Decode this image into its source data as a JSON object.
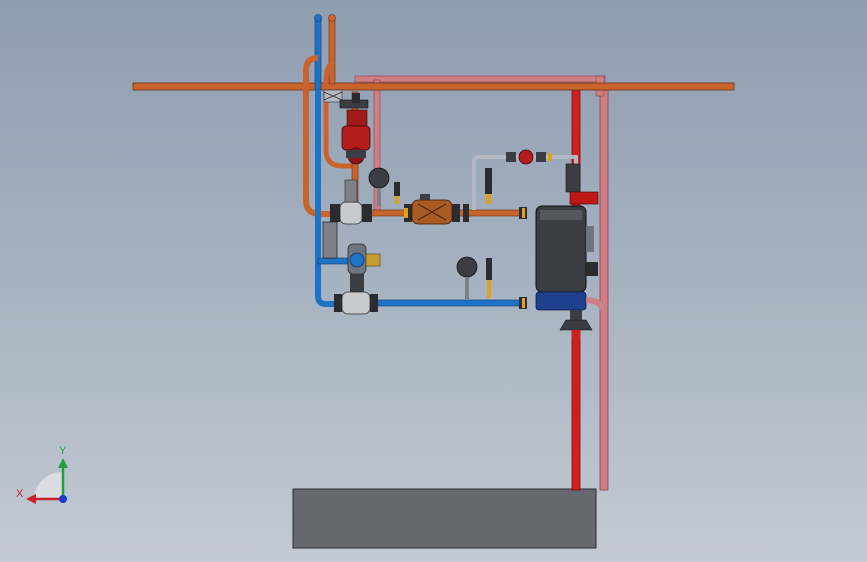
{
  "triad": {
    "x_label": "X",
    "y_label": "Y"
  },
  "colors": {
    "background_top": "#8e9db0",
    "background_bottom": "#c3cad3",
    "hot_pipe": "#c8642c",
    "cold_pipe": "#1f73c6",
    "red_pipe": "#d11e1e",
    "pink_pipe": "#cf7f84",
    "gray_pipe": "#b4b8c4",
    "heat_exchanger": "#3b3d44",
    "base_block": "#65686f",
    "triad_x": "#c8202a",
    "triad_y": "#20a038",
    "triad_z": "#2038d0"
  },
  "icons": [
    "x-axis-arrow-icon",
    "y-axis-arrow-icon",
    "z-axis-dot-icon",
    "origin-cone-icon"
  ]
}
